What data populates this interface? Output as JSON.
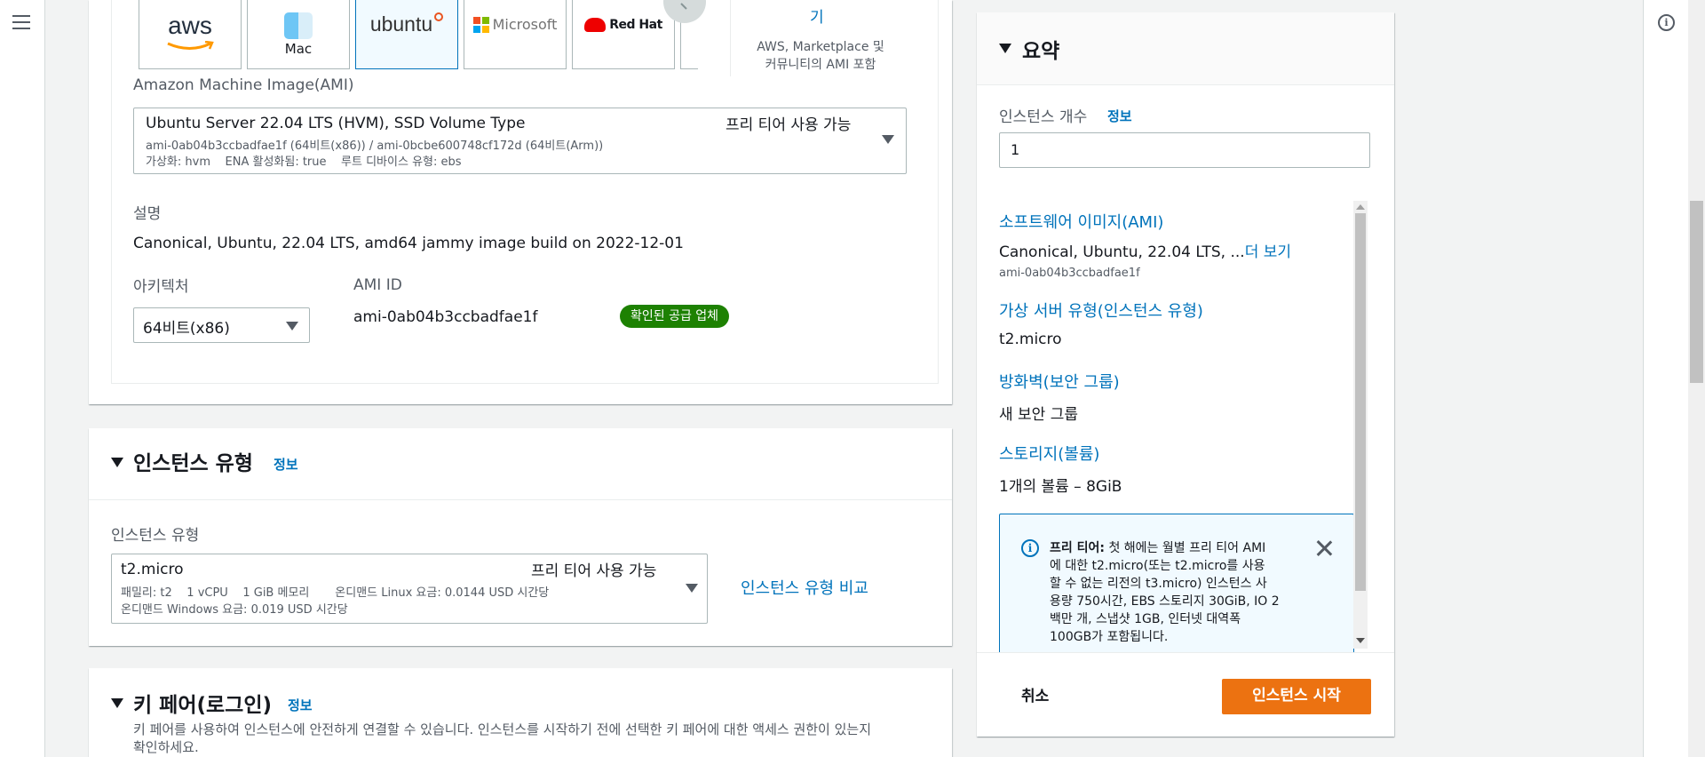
{
  "nav": {
    "menu_icon": "hamburger-icon"
  },
  "tools": {
    "info_icon": "info-icon",
    "info_glyph": "i"
  },
  "ami_section": {
    "tiles": [
      "aws",
      "Mac",
      "ubuntu",
      "Microsoft",
      "Red Hat"
    ],
    "browse_more_suffix": "기",
    "browse_note_line1": "AWS, Marketplace 및",
    "browse_note_line2": "커뮤니티의 AMI 포함",
    "ami_label": "Amazon Machine Image(AMI)",
    "selected_name": "Ubuntu Server 22.04 LTS (HVM), SSD Volume Type",
    "free_tier_label": "프리 티어 사용 가능",
    "ami_ids_line": "ami-0ab04b3ccbadfae1f (64비트(x86)) / ami-0bcbe600748cf172d (64비트(Arm))",
    "attrs_line": "가상화: hvm    ENA 활성화됨: true    루트 디바이스 유형: ebs",
    "desc_label": "설명",
    "desc_value": "Canonical, Ubuntu, 22.04 LTS, amd64 jammy image build on 2022-12-01",
    "arch_label": "아키텍처",
    "arch_value": "64비트(x86)",
    "ami_id_label": "AMI ID",
    "ami_id_value": "ami-0ab04b3ccbadfae1f",
    "verified_badge": "확인된 공급 업체"
  },
  "instance_type_section": {
    "title": "인스턴스 유형",
    "info": "정보",
    "field_label": "인스턴스 유형",
    "selected": "t2.micro",
    "free_tier_label": "프리 티어 사용 가능",
    "details_line1": "패밀리: t2    1 vCPU    1 GiB 메모리       온디맨드 Linux 요금: 0.0144 USD 시간당",
    "details_line2": "온디맨드 Windows 요금: 0.019 USD 시간당",
    "compare_link": "인스턴스 유형 비교"
  },
  "key_pair_section": {
    "title": "키 페어(로그인)",
    "info": "정보",
    "desc_line1": "키 페어를 사용하여 인스턴스에 안전하게 연결할 수 있습니다. 인스턴스를 시작하기 전에 선택한 키 페어에 대한 액세스 권한이 있는지",
    "desc_line2": "확인하세요."
  },
  "summary": {
    "title": "요약",
    "count_label": "인스턴스 개수",
    "count_info": "정보",
    "count_value": "1",
    "ami_link": "소프트웨어 이미지(AMI)",
    "ami_value": "Canonical, Ubuntu, 22.04 LTS, ...",
    "ami_more": "더 보기",
    "ami_id": "ami-0ab04b3ccbadfae1f",
    "type_link": "가상 서버 유형(인스턴스 유형)",
    "type_value": "t2.micro",
    "fw_link": "방화벽(보안 그룹)",
    "fw_value": "새 보안 그룹",
    "storage_link": "스토리지(볼륨)",
    "storage_value": "1개의 볼륨 – 8GiB",
    "alert_bold": "프리 티어:",
    "alert_lines": [
      " 첫 해에는 월별 프리 티어 AMI",
      "에 대한 t2.micro(또는 t2.micro를 사용",
      "할 수 없는 리전의 t3.micro) 인스턴스 사",
      "용량 750시간, EBS 스토리지 30GiB, IO 2",
      "백만 개, 스냅샷 1GB, 인터넷 대역폭",
      "100GB가 포함됩니다."
    ],
    "cancel": "취소",
    "launch": "인스턴스 시작"
  }
}
